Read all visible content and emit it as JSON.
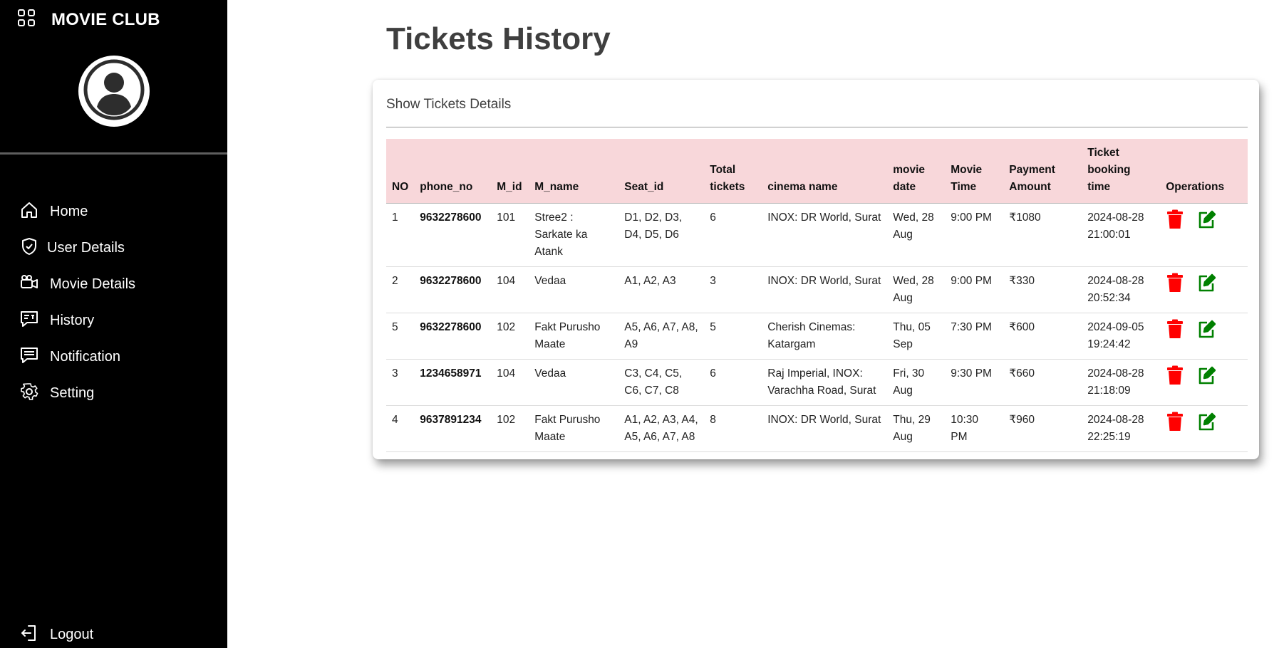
{
  "app": {
    "brand": "MOVIE CLUB"
  },
  "sidebar": {
    "items": [
      {
        "label": "Home",
        "icon": "home-icon"
      },
      {
        "label": "User Details",
        "icon": "shield-check-icon"
      },
      {
        "label": "Movie Details",
        "icon": "camera-icon"
      },
      {
        "label": "History",
        "icon": "chat-square-icon"
      },
      {
        "label": "Notification",
        "icon": "message-icon"
      },
      {
        "label": "Setting",
        "icon": "gear-icon"
      }
    ],
    "logout": {
      "label": "Logout",
      "icon": "logout-icon"
    }
  },
  "main": {
    "title": "Tickets History",
    "card_title": "Show Tickets Details"
  },
  "table": {
    "headers": {
      "no": "NO",
      "phone": "phone_no",
      "mid": "M_id",
      "mname": "M_name",
      "seat": "Seat_id",
      "total": "Total tickets",
      "cinema": "cinema name",
      "date": "movie date",
      "time": "Movie Time",
      "amount": "Payment Amount",
      "booking": "Ticket booking time",
      "ops": "Operations"
    },
    "rows": [
      {
        "no": "1",
        "phone": "9632278600",
        "mid": "101",
        "mname": "Stree2 : Sarkate ka Atank",
        "seat": "D1, D2, D3, D4, D5, D6",
        "total": "6",
        "cinema": "INOX: DR World, Surat",
        "date": "Wed, 28 Aug",
        "time": "9:00 PM",
        "amount": "₹1080",
        "booking": "2024-08-28 21:00:01"
      },
      {
        "no": "2",
        "phone": "9632278600",
        "mid": "104",
        "mname": "Vedaa",
        "seat": "A1, A2, A3",
        "total": "3",
        "cinema": "INOX: DR World, Surat",
        "date": "Wed, 28 Aug",
        "time": "9:00 PM",
        "amount": "₹330",
        "booking": "2024-08-28 20:52:34"
      },
      {
        "no": "5",
        "phone": "9632278600",
        "mid": "102",
        "mname": "Fakt Purusho Maate",
        "seat": "A5, A6, A7, A8, A9",
        "total": "5",
        "cinema": "Cherish Cinemas: Katargam",
        "date": "Thu, 05 Sep",
        "time": "7:30 PM",
        "amount": "₹600",
        "booking": "2024-09-05 19:24:42"
      },
      {
        "no": "3",
        "phone": "1234658971",
        "mid": "104",
        "mname": "Vedaa",
        "seat": "C3, C4, C5, C6, C7, C8",
        "total": "6",
        "cinema": "Raj Imperial, INOX: Varachha Road, Surat",
        "date": "Fri, 30 Aug",
        "time": "9:30 PM",
        "amount": "₹660",
        "booking": "2024-08-28 21:18:09"
      },
      {
        "no": "4",
        "phone": "9637891234",
        "mid": "102",
        "mname": "Fakt Purusho Maate",
        "seat": "A1, A2, A3, A4, A5, A6, A7, A8",
        "total": "8",
        "cinema": "INOX: DR World, Surat",
        "date": "Thu, 29 Aug",
        "time": "10:30 PM",
        "amount": "₹960",
        "booking": "2024-08-28 22:25:19"
      }
    ],
    "delete_icon": "trash-icon",
    "edit_icon": "edit-icon",
    "delete_color": "#ff0000",
    "edit_color": "#008000"
  },
  "colors": {
    "sidebar_bg": "#000000",
    "header_row_bg": "#f8d7da",
    "title_text": "#3f3f3f"
  }
}
